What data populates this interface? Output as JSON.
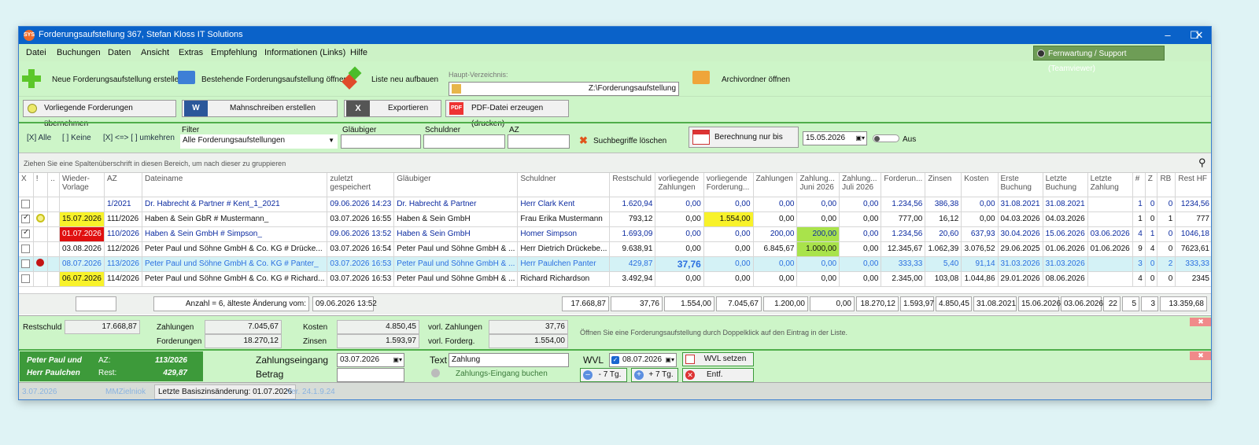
{
  "window": {
    "title": "Forderungsaufstellung 367, Stefan Kloss IT Solutions",
    "icon_text": "SYS"
  },
  "menu": [
    "Datei",
    "Buchungen",
    "Daten",
    "Ansicht",
    "Extras",
    "Empfehlung",
    "Informationen (Links)",
    "Hilfe"
  ],
  "support_button": "Fernwartung / Support (Teamviewer)",
  "toolbar": {
    "new": "Neue Forderungsaufstellung erstellen",
    "open": "Bestehende Forderungsaufstellung öffnen",
    "rebuild": "Liste neu aufbauen",
    "main_dir_label": "Haupt-Verzeichnis:",
    "main_dir_value": "Z:\\Forderungsaufstellung",
    "archive": "Archivordner öffnen",
    "accept": "Vorliegende Forderungen übernehmen",
    "letters": "Mahnschreiben erstellen",
    "export": "Exportieren",
    "pdf": "PDF-Datei erzeugen (drucken)"
  },
  "filters": {
    "all": "[X] Alle",
    "none": "[  ] Keine",
    "invert": "[X] <=> [  ]  umkehren",
    "filter_label": "Filter",
    "filter_value": "Alle Forderungsaufstellungen",
    "creditor_label": "Gläubiger",
    "debtor_label": "Schuldner",
    "az_label": "AZ",
    "clear": "Suchbegriffe löschen",
    "calc_until": "Berechnung nur bis Datum",
    "date": "15.05.2026",
    "toggle": "Aus"
  },
  "group_hint": "Ziehen Sie eine Spaltenüberschrift in diesen Bereich, um nach dieser zu gruppieren",
  "columns": [
    "X",
    "!",
    "..",
    "Wieder-\nVorlage",
    "AZ",
    "Dateiname",
    "zuletzt\ngespeichert",
    "Gläubiger",
    "Schuldner",
    "Restschuld",
    "vorliegende\nZahlungen",
    "vorliegende\nForderung...",
    "Zahlungen",
    "Zahlung...\nJuni 2026",
    "Zahlung...\nJuli 2026",
    "Forderun...",
    "Zinsen",
    "Kosten",
    "Erste\nBuchung",
    "Letzte\nBuchung",
    "Letzte\nZahlung",
    "#",
    "Z",
    "RB",
    "Rest HF"
  ],
  "rows": [
    {
      "x": false,
      "wv": "",
      "az": "1/2021",
      "file": "Dr. Habrecht & Partner # Kent_1_2021",
      "saved": "09.06.2026 14:23",
      "glaub": "Dr. Habrecht & Partner",
      "schuld": "Herr Clark Kent",
      "rest": "1.620,94",
      "vz": "0,00",
      "vf": "0,00",
      "zahl": "0,00",
      "zjun": "0,00",
      "zjul": "0,00",
      "ford": "1.234,56",
      "zins": "386,38",
      "kost": "0,00",
      "erste": "31.08.2021",
      "letzte": "31.08.2021",
      "lz": "",
      "n": "1",
      "z": "0",
      "rb": "0",
      "resthf": "1234,56"
    },
    {
      "x": true,
      "wv": "15.07.2026",
      "az": "111/2026",
      "file": "Haben & Sein GbR # Mustermann_",
      "saved": "03.07.2026 16:55",
      "glaub": "Haben & Sein GmbH",
      "schuld": "Frau Erika Mustermann",
      "rest": "793,12",
      "vz": "0,00",
      "vf": "1.554,00",
      "zahl": "0,00",
      "zjun": "0,00",
      "zjul": "0,00",
      "ford": "777,00",
      "zins": "16,12",
      "kost": "0,00",
      "erste": "04.03.2026",
      "letzte": "04.03.2026",
      "lz": "",
      "n": "1",
      "z": "0",
      "rb": "1",
      "resthf": "777"
    },
    {
      "x": true,
      "wv": "01.07.2026",
      "az": "110/2026",
      "file": "Haben & Sein GmbH # Simpson_",
      "saved": "09.06.2026 13:52",
      "glaub": "Haben & Sein GmbH",
      "schuld": "Homer Simpson",
      "rest": "1.693,09",
      "vz": "0,00",
      "vf": "0,00",
      "zahl": "200,00",
      "zjun": "200,00",
      "zjul": "0,00",
      "ford": "1.234,56",
      "zins": "20,60",
      "kost": "637,93",
      "erste": "30.04.2026",
      "letzte": "15.06.2026",
      "lz": "03.06.2026",
      "n": "4",
      "z": "1",
      "rb": "0",
      "resthf": "1046,18"
    },
    {
      "x": false,
      "wv": "03.08.2026",
      "az": "112/2026",
      "file": "Peter Paul und Söhne GmbH & Co. KG # Drücke...",
      "saved": "03.07.2026 16:54",
      "glaub": "Peter Paul und Söhne GmbH & ...",
      "schuld": "Herr Dietrich Drückebe...",
      "rest": "9.638,91",
      "vz": "0,00",
      "vf": "0,00",
      "zahl": "6.845,67",
      "zjun": "1.000,00",
      "zjul": "0,00",
      "ford": "12.345,67",
      "zins": "1.062,39",
      "kost": "3.076,52",
      "erste": "29.06.2025",
      "letzte": "01.06.2026",
      "lz": "01.06.2026",
      "n": "9",
      "z": "4",
      "rb": "0",
      "resthf": "7623,61"
    },
    {
      "x": false,
      "wv": "08.07.2026",
      "az": "113/2026",
      "file": "Peter Paul und Söhne GmbH & Co. KG # Panter_",
      "saved": "03.07.2026 16:53",
      "glaub": "Peter Paul und Söhne GmbH & ...",
      "schuld": "Herr Paulchen Panter",
      "rest": "429,87",
      "vz": "37,76",
      "vf": "0,00",
      "zahl": "0,00",
      "zjun": "0,00",
      "zjul": "0,00",
      "ford": "333,33",
      "zins": "5,40",
      "kost": "91,14",
      "erste": "31.03.2026",
      "letzte": "31.03.2026",
      "lz": "",
      "n": "3",
      "z": "0",
      "rb": "2",
      "resthf": "333,33"
    },
    {
      "x": false,
      "wv": "06.07.2026",
      "az": "114/2026",
      "file": "Peter Paul und Söhne GmbH & Co. KG # Richard...",
      "saved": "03.07.2026 16:53",
      "glaub": "Peter Paul und Söhne GmbH & ...",
      "schuld": "Richard Richardson",
      "rest": "3.492,94",
      "vz": "0,00",
      "vf": "0,00",
      "zahl": "0,00",
      "zjun": "0,00",
      "zjul": "0,00",
      "ford": "2.345,00",
      "zins": "103,08",
      "kost": "1.044,86",
      "erste": "29.01.2026",
      "letzte": "08.06.2026",
      "lz": "",
      "n": "4",
      "z": "0",
      "rb": "0",
      "resthf": "2345"
    }
  ],
  "footer": {
    "count": "Anzahl = 6,  älteste Änderung vom:",
    "oldest": "09.06.2026 13:52",
    "rest": "17.668,87",
    "vz": "37,76",
    "vf": "1.554,00",
    "zahl": "7.045,67",
    "zjun": "1.200,00",
    "zjul": "0,00",
    "ford": "18.270,12",
    "zins": "1.593,97",
    "kost": "4.850,45",
    "erste": "31.08.2021",
    "letzte": "15.06.2026",
    "lz": "03.06.2026",
    "n": "22",
    "z": "5",
    "rb": "3",
    "resthf": "13.359,68"
  },
  "summary": {
    "rest_label": "Restschuld",
    "rest": "17.668,87",
    "zahl_label": "Zahlungen",
    "zahl": "7.045,67",
    "ford_label": "Forderungen",
    "ford": "18.270,12",
    "kost_label": "Kosten",
    "kost": "4.850,45",
    "zins_label": "Zinsen",
    "zins": "1.593,97",
    "vz_label": "vorl. Zahlungen",
    "vz": "37,76",
    "vf_label": "vorl. Forderg.",
    "vf": "1.554,00",
    "hint": "Öffnen Sie eine Forderungsaufstellung durch Doppelklick auf den Eintrag in der Liste."
  },
  "detail": {
    "name1": "Peter Paul und",
    "name2": "Herr Paulchen",
    "az_label": "AZ:",
    "az": "113/2026",
    "rest_label": "Rest:",
    "rest": "429,87",
    "pay_label": "Zahlungseingang",
    "pay_date": "03.07.2026",
    "amount_label": "Betrag",
    "text_label": "Text",
    "text_value": "Zahlung",
    "book": "Zahlungs-Eingang buchen",
    "wvl_label": "WVL",
    "wvl_date": "08.07.2026",
    "wvl_set": "WVL setzen",
    "minus7": "- 7 Tg.",
    "plus7": "+ 7 Tg.",
    "remove": "Entf."
  },
  "status": {
    "date": "3.07.2026",
    "user": "MMZielniok",
    "basis": "Letzte Basiszinsänderung: 01.07.2026",
    "version": "Ver. 24.1.9.24"
  },
  "colors": {
    "titlebar": "#0a62c9",
    "window_bg": "#cdf5c8",
    "dark_green": "#3d9a3a",
    "highlight_yellow": "#f8f22a",
    "highlight_red": "#e01010",
    "highlight_lime": "#a9e34b"
  }
}
